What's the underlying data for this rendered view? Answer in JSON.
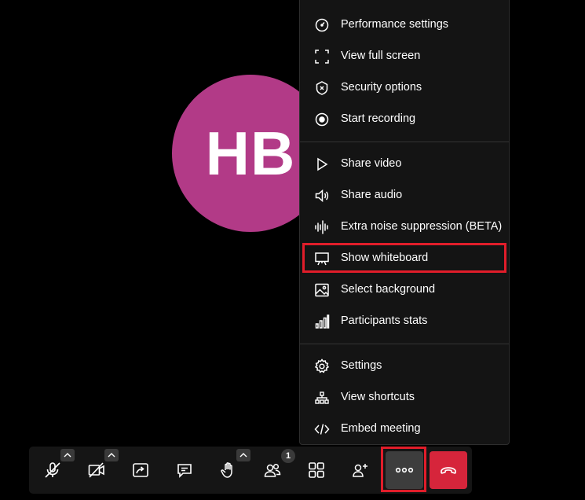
{
  "participant": {
    "initials": "HB",
    "avatar_color": "#b23a87"
  },
  "menu": {
    "sections": [
      [
        {
          "label": "Performance settings",
          "icon": "gauge-icon"
        },
        {
          "label": "View full screen",
          "icon": "fullscreen-icon"
        },
        {
          "label": "Security options",
          "icon": "shield-icon"
        },
        {
          "label": "Start recording",
          "icon": "record-icon"
        }
      ],
      [
        {
          "label": "Share video",
          "icon": "play-icon"
        },
        {
          "label": "Share audio",
          "icon": "speaker-icon"
        },
        {
          "label": "Extra noise suppression (BETA)",
          "icon": "waveform-icon"
        },
        {
          "label": "Show whiteboard",
          "icon": "whiteboard-icon",
          "highlighted": true
        },
        {
          "label": "Select background",
          "icon": "image-icon"
        },
        {
          "label": "Participants stats",
          "icon": "bar-chart-icon"
        }
      ],
      [
        {
          "label": "Settings",
          "icon": "gear-icon"
        },
        {
          "label": "View shortcuts",
          "icon": "shortcuts-icon"
        },
        {
          "label": "Embed meeting",
          "icon": "code-icon"
        }
      ]
    ]
  },
  "toolbar": {
    "buttons": [
      {
        "name": "microphone-muted",
        "icon": "microphone-off-icon",
        "has_caret": true
      },
      {
        "name": "camera-off",
        "icon": "camera-off-icon",
        "has_caret": true
      },
      {
        "name": "screen-share",
        "icon": "screen-share-icon"
      },
      {
        "name": "chat",
        "icon": "chat-icon"
      },
      {
        "name": "raise-hand",
        "icon": "hand-icon",
        "has_caret": true
      },
      {
        "name": "participants",
        "icon": "participants-icon",
        "badge": "1"
      },
      {
        "name": "tile-view",
        "icon": "grid-icon"
      },
      {
        "name": "invite",
        "icon": "add-person-icon"
      }
    ],
    "more_icon": "ellipsis-icon",
    "hangup_icon": "phone-hangup-icon",
    "hangup_color": "#d6253b",
    "highlight_color": "#e11d2a"
  }
}
